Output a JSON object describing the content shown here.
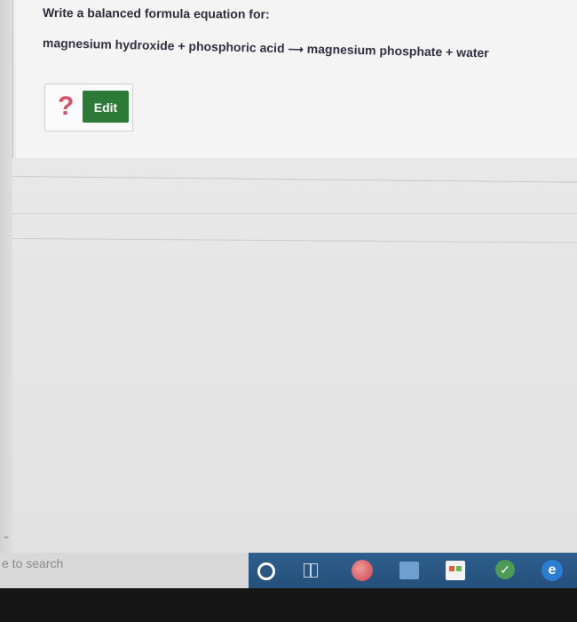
{
  "question": {
    "prompt": "Write a balanced formula equation for:",
    "reactants": "magnesium hydroxide + phosphoric acid",
    "products": "magnesium phosphate + water"
  },
  "answer_widget": {
    "help_symbol": "?",
    "edit_label": "Edit"
  },
  "taskbar": {
    "search_placeholder": "e to search"
  }
}
